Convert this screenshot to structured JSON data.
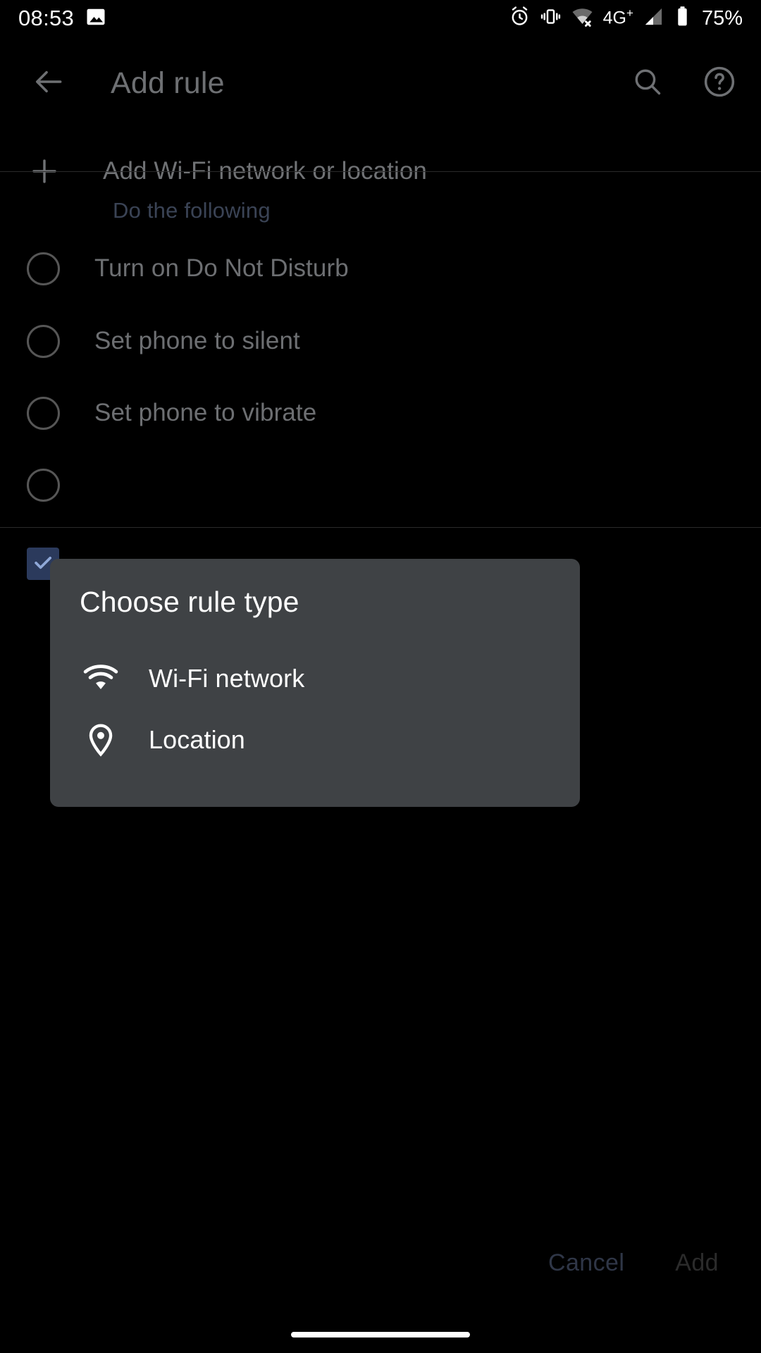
{
  "status_bar": {
    "time": "08:53",
    "left_icons": [
      "image-icon"
    ],
    "right_icons": [
      "alarm-icon",
      "vibrate-icon",
      "wifi-off-icon",
      "signal-bars-icon",
      "battery-icon"
    ],
    "network_label": "4G",
    "network_superscript": "+",
    "battery_percent": "75%"
  },
  "toolbar": {
    "back_icon": "arrow-back-icon",
    "title": "Add rule",
    "search_icon": "search-icon",
    "help_icon": "help-circle-icon"
  },
  "content": {
    "add_row": {
      "icon": "plus-icon",
      "label": "Add Wi-Fi network or location"
    },
    "section_header": "Do the following",
    "options": [
      {
        "label": "Turn on Do Not Disturb",
        "selected": false
      },
      {
        "label": "Set phone to silent",
        "selected": false
      },
      {
        "label": "Set phone to vibrate",
        "selected": false
      },
      {
        "label": "",
        "selected": false
      }
    ],
    "checkbox_row": {
      "icon": "check-icon",
      "checked": true,
      "label": ""
    }
  },
  "dialog": {
    "title": "Choose rule type",
    "items": [
      {
        "icon": "wifi-icon",
        "label": "Wi-Fi network"
      },
      {
        "icon": "location-pin-icon",
        "label": "Location"
      }
    ]
  },
  "bottom_bar": {
    "cancel_label": "Cancel",
    "add_label": "Add"
  },
  "colors": {
    "background": "#000000",
    "dialog_background": "#3f4245",
    "accent_dim": "#3a4355",
    "text_dim": "#6d6f72",
    "text_primary": "#ffffff",
    "checkbox_fill": "#2b3a5c"
  }
}
